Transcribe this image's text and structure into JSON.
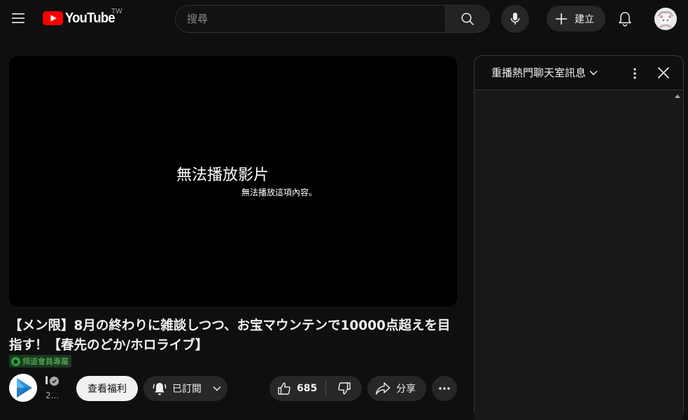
{
  "header": {
    "logo_text": "YouTube",
    "country_code": "TW",
    "search_placeholder": "搜尋",
    "create_label": "建立"
  },
  "player": {
    "error_title": "無法播放影片",
    "error_message": "無法播放這項內容。"
  },
  "video": {
    "title": "【メン限】8月の終わりに雑談しつつ、お宝マウンテンで10000点超えを目指す！【春先のどか/ホロライブ】",
    "members_badge": "頻道會員專屬"
  },
  "channel": {
    "name": "l",
    "subscribers": "2...",
    "perks_label": "查看福利",
    "subscribe_label": "已訂閱"
  },
  "actions": {
    "like_count": "685",
    "share_label": "分享"
  },
  "chat": {
    "title": "重播熱門聊天室訊息"
  },
  "colors": {
    "background": "#0f0f0f",
    "brand_red": "#ff0000",
    "members_green": "#2ba640",
    "chip_background": "#272727"
  }
}
